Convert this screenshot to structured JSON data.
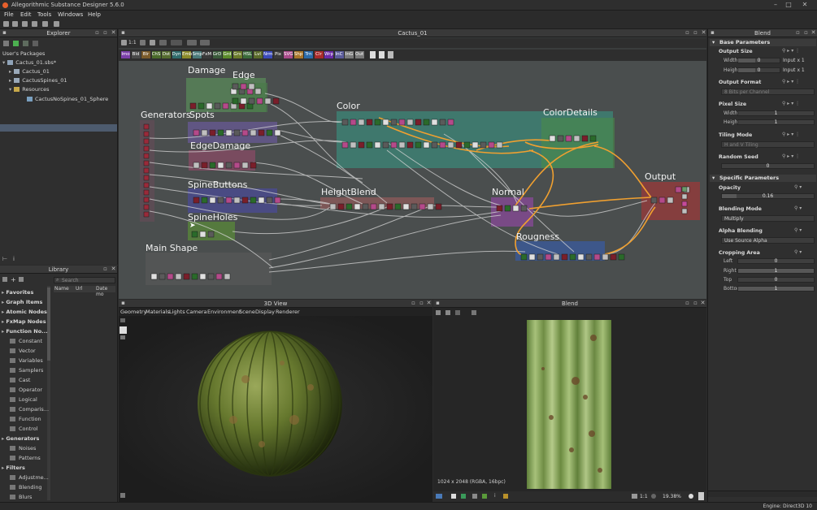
{
  "app": {
    "title": "Allegorithmic Substance Designer 5.6.0"
  },
  "menu": [
    "File",
    "Edit",
    "Tools",
    "Windows",
    "Help"
  ],
  "explorer": {
    "title": "Explorer",
    "section_label": "User's Packages",
    "tree": [
      {
        "label": "Cactus_01.sbs*",
        "level": 0
      },
      {
        "label": "Cactus_01",
        "level": 1
      },
      {
        "label": "CactusSpines_01",
        "level": 1
      },
      {
        "label": "Resources",
        "level": 1
      },
      {
        "label": "CactusNoSpines_01_Sphere",
        "level": 2
      }
    ]
  },
  "library": {
    "title": "Library",
    "search_placeholder": "Search",
    "columns": [
      "Name",
      "Url",
      "Date mo"
    ],
    "items": [
      {
        "label": "Favorites",
        "type": "cat"
      },
      {
        "label": "Graph Items",
        "type": "cat"
      },
      {
        "label": "Atomic Nodes",
        "type": "cat"
      },
      {
        "label": "FxMap Nodes",
        "type": "cat"
      },
      {
        "label": "Function No...",
        "type": "cat"
      },
      {
        "label": "Constant",
        "type": "sub"
      },
      {
        "label": "Vector",
        "type": "sub"
      },
      {
        "label": "Variables",
        "type": "sub"
      },
      {
        "label": "Samplers",
        "type": "sub"
      },
      {
        "label": "Cast",
        "type": "sub"
      },
      {
        "label": "Operator",
        "type": "sub"
      },
      {
        "label": "Logical",
        "type": "sub"
      },
      {
        "label": "Comparis...",
        "type": "sub"
      },
      {
        "label": "Function",
        "type": "sub"
      },
      {
        "label": "Control",
        "type": "sub"
      },
      {
        "label": "Generators",
        "type": "cat"
      },
      {
        "label": "Noises",
        "type": "sub"
      },
      {
        "label": "Patterns",
        "type": "sub"
      },
      {
        "label": "Filters",
        "type": "cat"
      },
      {
        "label": "Adjustme...",
        "type": "sub"
      },
      {
        "label": "Blending",
        "type": "sub"
      },
      {
        "label": "Blurs",
        "type": "sub"
      }
    ]
  },
  "graph": {
    "title": "Cactus_01",
    "zoom_label": "1:1",
    "filters": [
      {
        "label": "Imo",
        "color": "#7b3fa8"
      },
      {
        "label": "Bld",
        "color": "#4a4a4a"
      },
      {
        "label": "Blr",
        "color": "#7a5a2a"
      },
      {
        "label": "ChS",
        "color": "#4a6a2a"
      },
      {
        "label": "Dst",
        "color": "#556b2f"
      },
      {
        "label": "Dyn",
        "color": "#2f6b6b"
      },
      {
        "label": "Emb",
        "color": "#8a8a2a"
      },
      {
        "label": "Smp",
        "color": "#4a7a7a"
      },
      {
        "label": "FxM",
        "color": "#3a3a3a"
      },
      {
        "label": "GrD",
        "color": "#3a5a3a"
      },
      {
        "label": "Grd",
        "color": "#5a8a2a"
      },
      {
        "label": "Grs",
        "color": "#6a7a2a"
      },
      {
        "label": "HSL",
        "color": "#3a6a3a"
      },
      {
        "label": "Lvl",
        "color": "#5a6a2a"
      },
      {
        "label": "Nrm",
        "color": "#3a4ab8"
      },
      {
        "label": "Pix",
        "color": "#3a3a3a"
      },
      {
        "label": "SVG",
        "color": "#a84a8a"
      },
      {
        "label": "Shp",
        "color": "#a8762a"
      },
      {
        "label": "Trn",
        "color": "#2a6aa8"
      },
      {
        "label": "Clr",
        "color": "#a82a2a"
      },
      {
        "label": "Wrp",
        "color": "#6a2aa8"
      },
      {
        "label": "InC",
        "color": "#5a5a9a"
      },
      {
        "label": "InG",
        "color": "#7a7a7a"
      },
      {
        "label": "Out",
        "color": "#7a7a7a"
      }
    ],
    "frames": [
      {
        "id": "damage",
        "title": "Damage"
      },
      {
        "id": "edge",
        "title": "Edge"
      },
      {
        "id": "generators",
        "title": "Generators"
      },
      {
        "id": "spots",
        "title": "Spots"
      },
      {
        "id": "edgedamage",
        "title": "EdgeDamage"
      },
      {
        "id": "spinebuttons",
        "title": "SpineButtons"
      },
      {
        "id": "spineholes",
        "title": "SpineHoles"
      },
      {
        "id": "mainshape",
        "title": "Main Shape"
      },
      {
        "id": "color",
        "title": "Color"
      },
      {
        "id": "colordetails",
        "title": "ColorDetails"
      },
      {
        "id": "heightblend",
        "title": "HeightBlend"
      },
      {
        "id": "normal",
        "title": "Normal"
      },
      {
        "id": "rougness",
        "title": "Rougness"
      },
      {
        "id": "output",
        "title": "Output"
      }
    ]
  },
  "view3d": {
    "title": "3D View",
    "menu": [
      "Geometry",
      "Materials",
      "Lights",
      "Camera",
      "Environment",
      "Scene",
      "Display",
      "Renderer"
    ]
  },
  "view2d": {
    "title": "Blend",
    "info": "1024 x 2048 (RGBA, 16bpc)",
    "zoom_ratio": "1:1",
    "zoom_percent": "19.38%"
  },
  "properties": {
    "title": "Blend",
    "base_section": "Base Parameters",
    "output_size": {
      "label": "Output Size",
      "width_label": "Width",
      "width_value": "0",
      "width_suffix": "Input x 1",
      "height_label": "Height",
      "height_value": "0",
      "height_suffix": "Input x 1"
    },
    "output_format": {
      "label": "Output Format",
      "value": "8 Bits per Channel"
    },
    "pixel_size": {
      "label": "Pixel Size",
      "width_label": "Width",
      "width_value": "1",
      "height_label": "Height",
      "height_value": "1"
    },
    "tiling_mode": {
      "label": "Tiling Mode",
      "value": "H and V Tiling"
    },
    "random_seed": {
      "label": "Random Seed",
      "value": "0"
    },
    "specific_section": "Specific Parameters",
    "opacity": {
      "label": "Opacity",
      "value": "0.16"
    },
    "blending_mode": {
      "label": "Blending Mode",
      "value": "Multiply"
    },
    "alpha_blending": {
      "label": "Alpha Blending",
      "value": "Use Source Alpha"
    },
    "cropping": {
      "label": "Cropping Area",
      "left_label": "Left",
      "left_value": "0",
      "right_label": "Right",
      "right_value": "1",
      "top_label": "Top",
      "top_value": "0",
      "bottom_label": "Bottom",
      "bottom_value": "1"
    }
  },
  "status": {
    "engine": "Engine: Direct3D 10"
  }
}
